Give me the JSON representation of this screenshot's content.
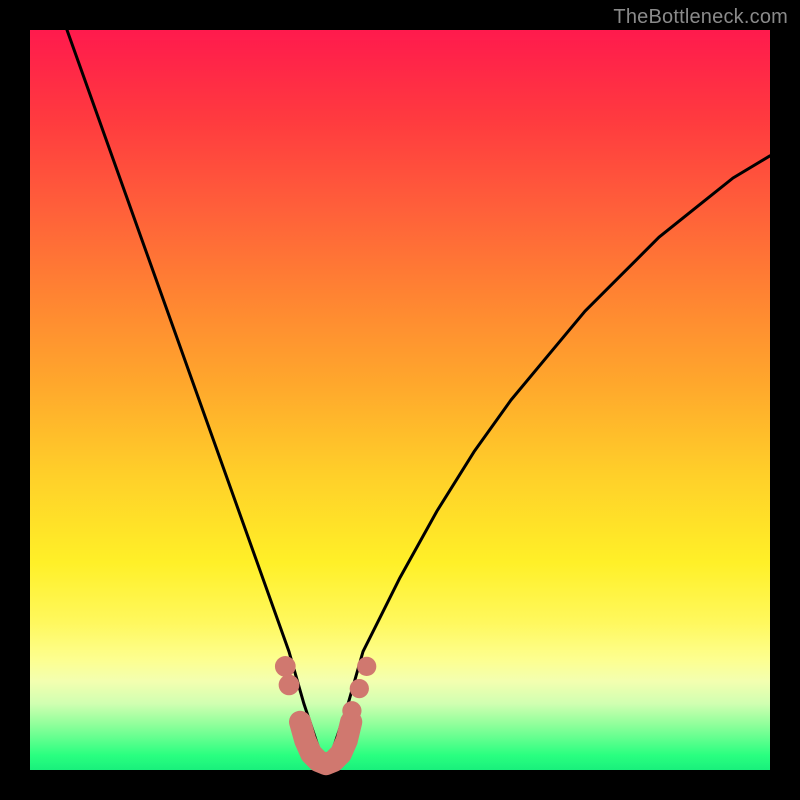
{
  "watermark": "TheBottleneck.com",
  "chart_data": {
    "type": "line",
    "title": "",
    "xlabel": "",
    "ylabel": "",
    "xlim": [
      0,
      100
    ],
    "ylim": [
      0,
      100
    ],
    "grid": false,
    "legend": false,
    "annotations": [],
    "series": [
      {
        "name": "bottleneck-curve",
        "color": "#000000",
        "x": [
          5,
          10,
          15,
          20,
          25,
          30,
          35,
          37,
          39,
          40,
          41,
          43,
          45,
          50,
          55,
          60,
          65,
          70,
          75,
          80,
          85,
          90,
          95,
          100
        ],
        "y": [
          100,
          86,
          72,
          58,
          44,
          30,
          16,
          9,
          3,
          1,
          3,
          9,
          16,
          26,
          35,
          43,
          50,
          56,
          62,
          67,
          72,
          76,
          80,
          83
        ]
      }
    ],
    "markers": [
      {
        "name": "left-pair-upper",
        "x": 34.5,
        "y": 14,
        "r": 1.4,
        "color": "#d0786f"
      },
      {
        "name": "left-pair-lower",
        "x": 35,
        "y": 11.5,
        "r": 1.4,
        "color": "#d0786f"
      },
      {
        "name": "right-top",
        "x": 45.5,
        "y": 14,
        "r": 1.3,
        "color": "#d0786f"
      },
      {
        "name": "right-mid",
        "x": 44.5,
        "y": 11,
        "r": 1.3,
        "color": "#d0786f"
      },
      {
        "name": "right-low",
        "x": 43.5,
        "y": 8,
        "r": 1.3,
        "color": "#d0786f"
      }
    ],
    "bottom_segment": {
      "name": "valley-thick-band",
      "color": "#d0786f",
      "x": [
        36.5,
        37.2,
        38,
        39,
        40,
        41,
        42,
        42.8,
        43.4
      ],
      "y": [
        6.5,
        4,
        2.2,
        1.2,
        0.8,
        1.2,
        2.2,
        4,
        6.5
      ],
      "width": 3.0
    }
  }
}
